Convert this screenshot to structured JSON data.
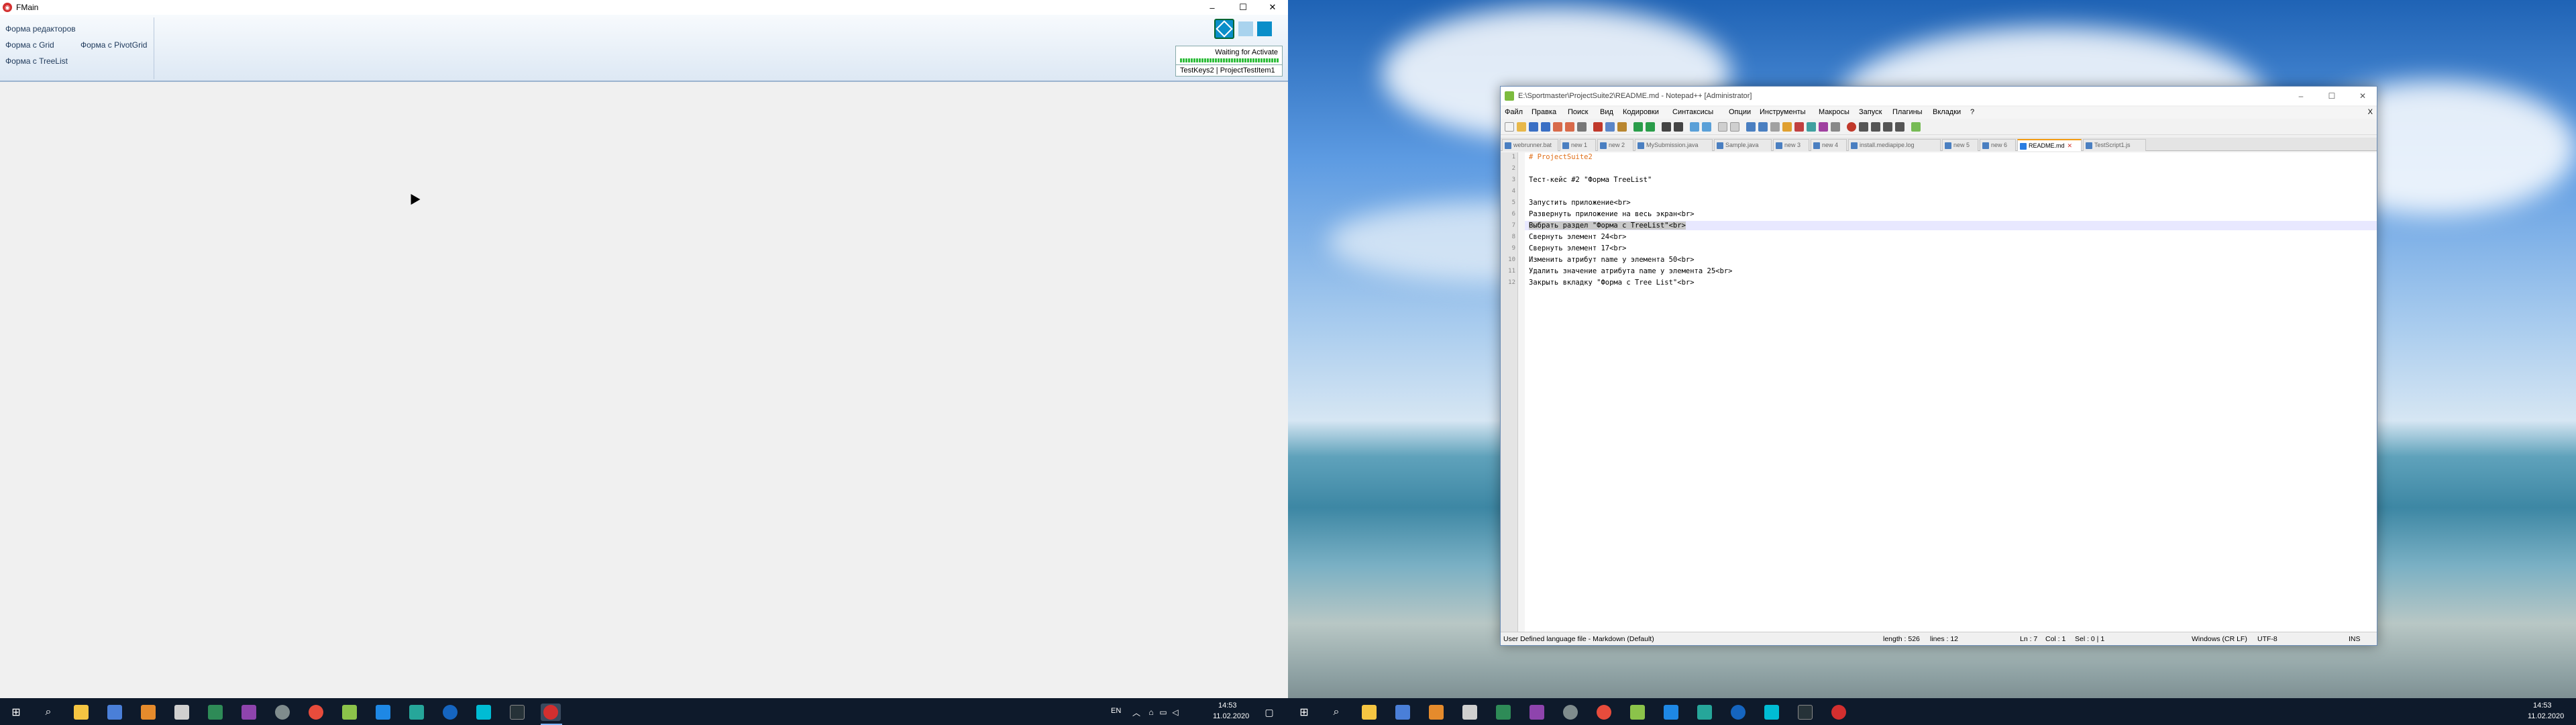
{
  "left_screen": {
    "window_title": "FMain",
    "window_controls": {
      "minimize": "–",
      "maximize": "☐",
      "close": "✕"
    },
    "ribbon": {
      "items": [
        {
          "label": "Форма редакторов"
        },
        {
          "label": "Форма с Grid"
        },
        {
          "label": "Форма с PivotGrid"
        },
        {
          "label": "Форма с TreeList"
        }
      ]
    },
    "status_box": {
      "title": "Waiting for Activate",
      "keys": "TestKeys2 | ProjectTestItem1"
    },
    "accent_color": "#0a8ec9"
  },
  "right_screen": {
    "notepad": {
      "title": "E:\\Sportmaster\\ProjectSuite2\\README.md - Notepad++ [Administrator]",
      "menu": [
        "Файл",
        "Правка",
        "Поиск",
        "Вид",
        "Кодировки",
        "Синтаксисы",
        "Опции",
        "Инструменты",
        "Макросы",
        "Запуск",
        "Плагины",
        "Вкладки",
        "?"
      ],
      "menu_close": "X",
      "tabs": [
        {
          "label": "webrunner.bat",
          "active": false
        },
        {
          "label": "new 1",
          "active": false
        },
        {
          "label": "new 2",
          "active": false
        },
        {
          "label": "MySubmission.java",
          "active": false
        },
        {
          "label": "Sample.java",
          "active": false
        },
        {
          "label": "new 3",
          "active": false
        },
        {
          "label": "new 4",
          "active": false
        },
        {
          "label": "install.mediapipe.log",
          "active": false
        },
        {
          "label": "new 5",
          "active": false
        },
        {
          "label": "new 6",
          "active": false
        },
        {
          "label": "README.md",
          "active": true
        },
        {
          "label": "TestScript1.js",
          "active": false
        }
      ],
      "lines": [
        {
          "n": "1",
          "text": "# ProjectSuite2"
        },
        {
          "n": "2",
          "text": ""
        },
        {
          "n": "3",
          "text": "Тест-кейс #2 \"Форма TreeList\""
        },
        {
          "n": "4",
          "text": ""
        },
        {
          "n": "5",
          "text": "Запустить приложение<br>"
        },
        {
          "n": "6",
          "text": "Развернуть приложение на весь экран<br>"
        },
        {
          "n": "7",
          "text": "Выбрать раздел \"Форма с TreeList\"<br>"
        },
        {
          "n": "8",
          "text": "Свернуть элемент 24<br>"
        },
        {
          "n": "9",
          "text": "Свернуть элемент 17<br>"
        },
        {
          "n": "10",
          "text": "Изменить атрибут name у элемента 50<br>"
        },
        {
          "n": "11",
          "text": "Удалить значение атрибута name у элемента 25<br>"
        },
        {
          "n": "12",
          "text": "Закрыть вкладку \"Форма с Tree List\"<br>"
        }
      ],
      "status": {
        "language": "User Defined language file - Markdown (Default)",
        "length": "length : 526",
        "lines": "lines : 12",
        "ln": "Ln : 7",
        "col": "Col : 1",
        "sel": "Sel : 0 | 1",
        "eol": "Windows (CR LF)",
        "encoding": "UTF-8",
        "ins": "INS"
      }
    }
  },
  "taskbar": {
    "lang": "EN",
    "time": "14:53",
    "date": "11.02.2020"
  }
}
